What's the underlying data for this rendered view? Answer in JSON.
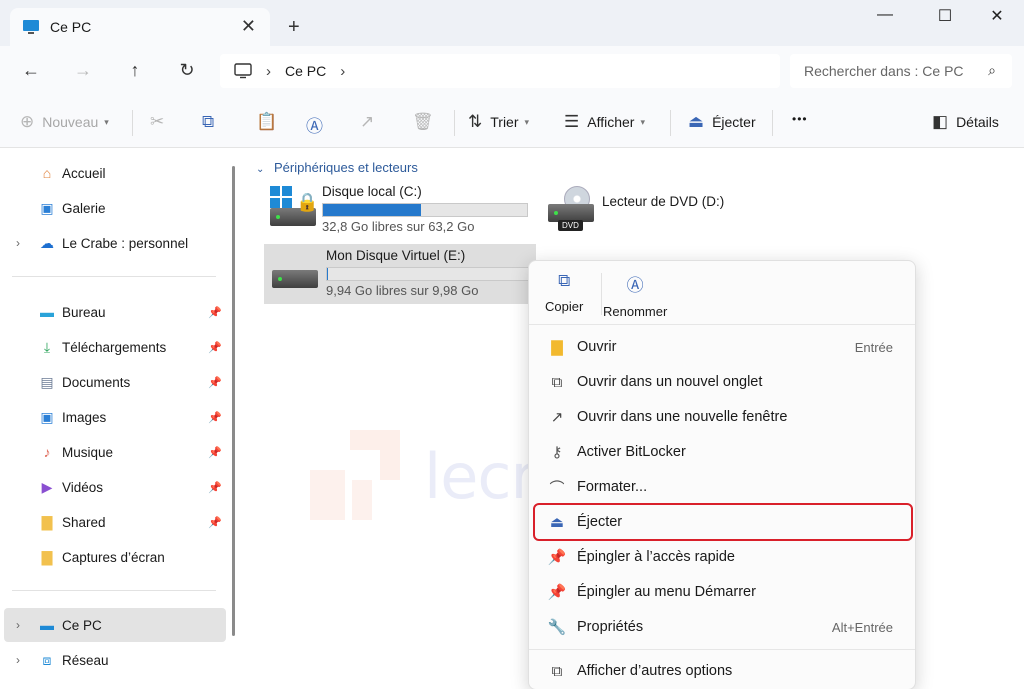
{
  "titlebar": {
    "tab_title": "Ce PC",
    "close_tab": "✕",
    "new_tab": "+",
    "minimize": "—",
    "maximize": "☐",
    "close": "✕"
  },
  "navbar": {
    "back": "←",
    "forward": "→",
    "up": "↑",
    "refresh": "↻",
    "breadcrumb": [
      "Ce PC"
    ],
    "search_placeholder": "Rechercher dans : Ce PC"
  },
  "toolbar": {
    "new_label": "Nouveau",
    "sort_label": "Trier",
    "view_label": "Afficher",
    "eject_label": "Éjecter",
    "more_label": "•••",
    "details_label": "Détails"
  },
  "sidebar": {
    "items": [
      {
        "label": "Accueil",
        "icon": "home-icon"
      },
      {
        "label": "Galerie",
        "icon": "gallery-icon"
      },
      {
        "label": "Le Crabe : personnel",
        "icon": "onedrive-icon"
      },
      {
        "label": "Bureau",
        "icon": "desktop-icon"
      },
      {
        "label": "Téléchargements",
        "icon": "download-icon"
      },
      {
        "label": "Documents",
        "icon": "documents-icon"
      },
      {
        "label": "Images",
        "icon": "images-icon"
      },
      {
        "label": "Musique",
        "icon": "music-icon"
      },
      {
        "label": "Vidéos",
        "icon": "videos-icon"
      },
      {
        "label": "Shared",
        "icon": "folder-icon"
      },
      {
        "label": "Captures d’écran",
        "icon": "folder-icon"
      },
      {
        "label": "Ce PC",
        "icon": "pc-icon"
      },
      {
        "label": "Réseau",
        "icon": "network-icon"
      }
    ]
  },
  "main": {
    "group_title": "Périphériques et lecteurs",
    "drives": [
      {
        "name": "Disque local (C:)",
        "free": "32,8 Go libres sur 63,2 Go",
        "used_fraction": 0.48
      },
      {
        "name": "Lecteur de DVD (D:)"
      },
      {
        "name": "Mon Disque Virtuel (E:)",
        "free": "9,94 Go libres sur 9,98 Go",
        "used_fraction": 0.004
      }
    ],
    "dvd_badge": "DVD"
  },
  "watermark": "lecrabeinfo",
  "context_menu": {
    "copy_label": "Copier",
    "rename_label": "Renommer",
    "items": [
      {
        "label": "Ouvrir",
        "shortcut": "Entrée"
      },
      {
        "label": "Ouvrir dans un nouvel onglet",
        "shortcut": ""
      },
      {
        "label": "Ouvrir dans une nouvelle fenêtre",
        "shortcut": ""
      },
      {
        "label": "Activer BitLocker",
        "shortcut": ""
      },
      {
        "label": "Formater...",
        "shortcut": ""
      },
      {
        "label": "Éjecter",
        "shortcut": ""
      },
      {
        "label": "Épingler à l’accès rapide",
        "shortcut": ""
      },
      {
        "label": "Épingler au menu Démarrer",
        "shortcut": ""
      },
      {
        "label": "Propriétés",
        "shortcut": "Alt+Entrée"
      },
      {
        "label": "Afficher d’autres options",
        "shortcut": ""
      }
    ]
  },
  "colors": {
    "accent": "#2679cc",
    "highlight_outline": "#d9202a"
  }
}
